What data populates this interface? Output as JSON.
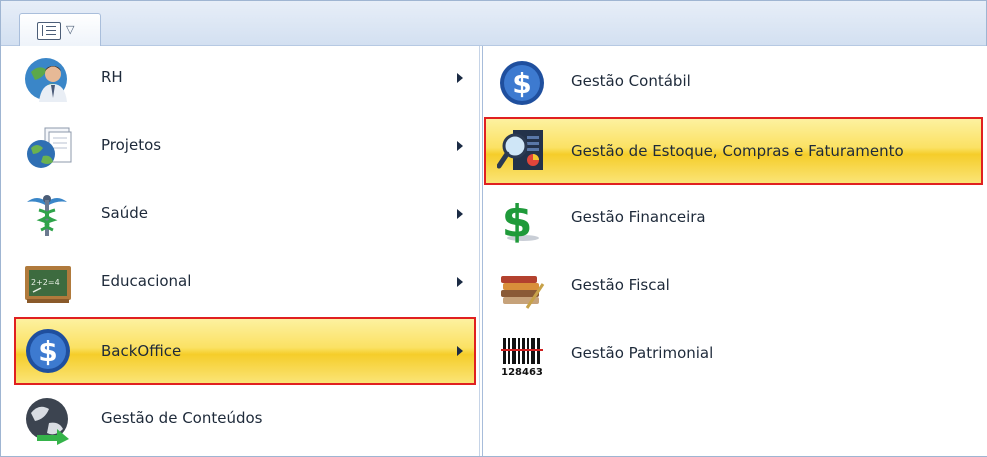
{
  "menu_button": {
    "icon": "sidebar-menu-icon",
    "caret_icon": "caret-down-icon"
  },
  "left_menu": {
    "items": [
      {
        "label": "RH",
        "icon": "person-globe-icon",
        "has_submenu": true,
        "selected": false
      },
      {
        "label": "Projetos",
        "icon": "globe-documents-icon",
        "has_submenu": true,
        "selected": false
      },
      {
        "label": "Saúde",
        "icon": "caduceus-icon",
        "has_submenu": true,
        "selected": false
      },
      {
        "label": "Educacional",
        "icon": "chalkboard-icon",
        "has_submenu": true,
        "selected": false
      },
      {
        "label": "BackOffice",
        "icon": "dollar-coin-icon",
        "has_submenu": true,
        "selected": true
      },
      {
        "label": "Gestão de Conteúdos",
        "icon": "globe-arrow-icon",
        "has_submenu": false,
        "selected": false
      }
    ]
  },
  "submenu": {
    "items": [
      {
        "label": "Gestão Contábil",
        "icon": "dollar-coin-icon",
        "selected": false
      },
      {
        "label": "Gestão de Estoque, Compras e Faturamento",
        "icon": "magnifier-chart-icon",
        "selected": true
      },
      {
        "label": "Gestão Financeira",
        "icon": "green-dollar-icon",
        "selected": false
      },
      {
        "label": "Gestão Fiscal",
        "icon": "books-pen-icon",
        "selected": false
      },
      {
        "label": "Gestão Patrimonial",
        "icon": "barcode-icon",
        "barcode_text": "128463",
        "selected": false
      }
    ]
  },
  "colors": {
    "highlight_border": "#e02020",
    "highlight_fill": "#fbe163",
    "frame_border": "#9fb5d2"
  }
}
